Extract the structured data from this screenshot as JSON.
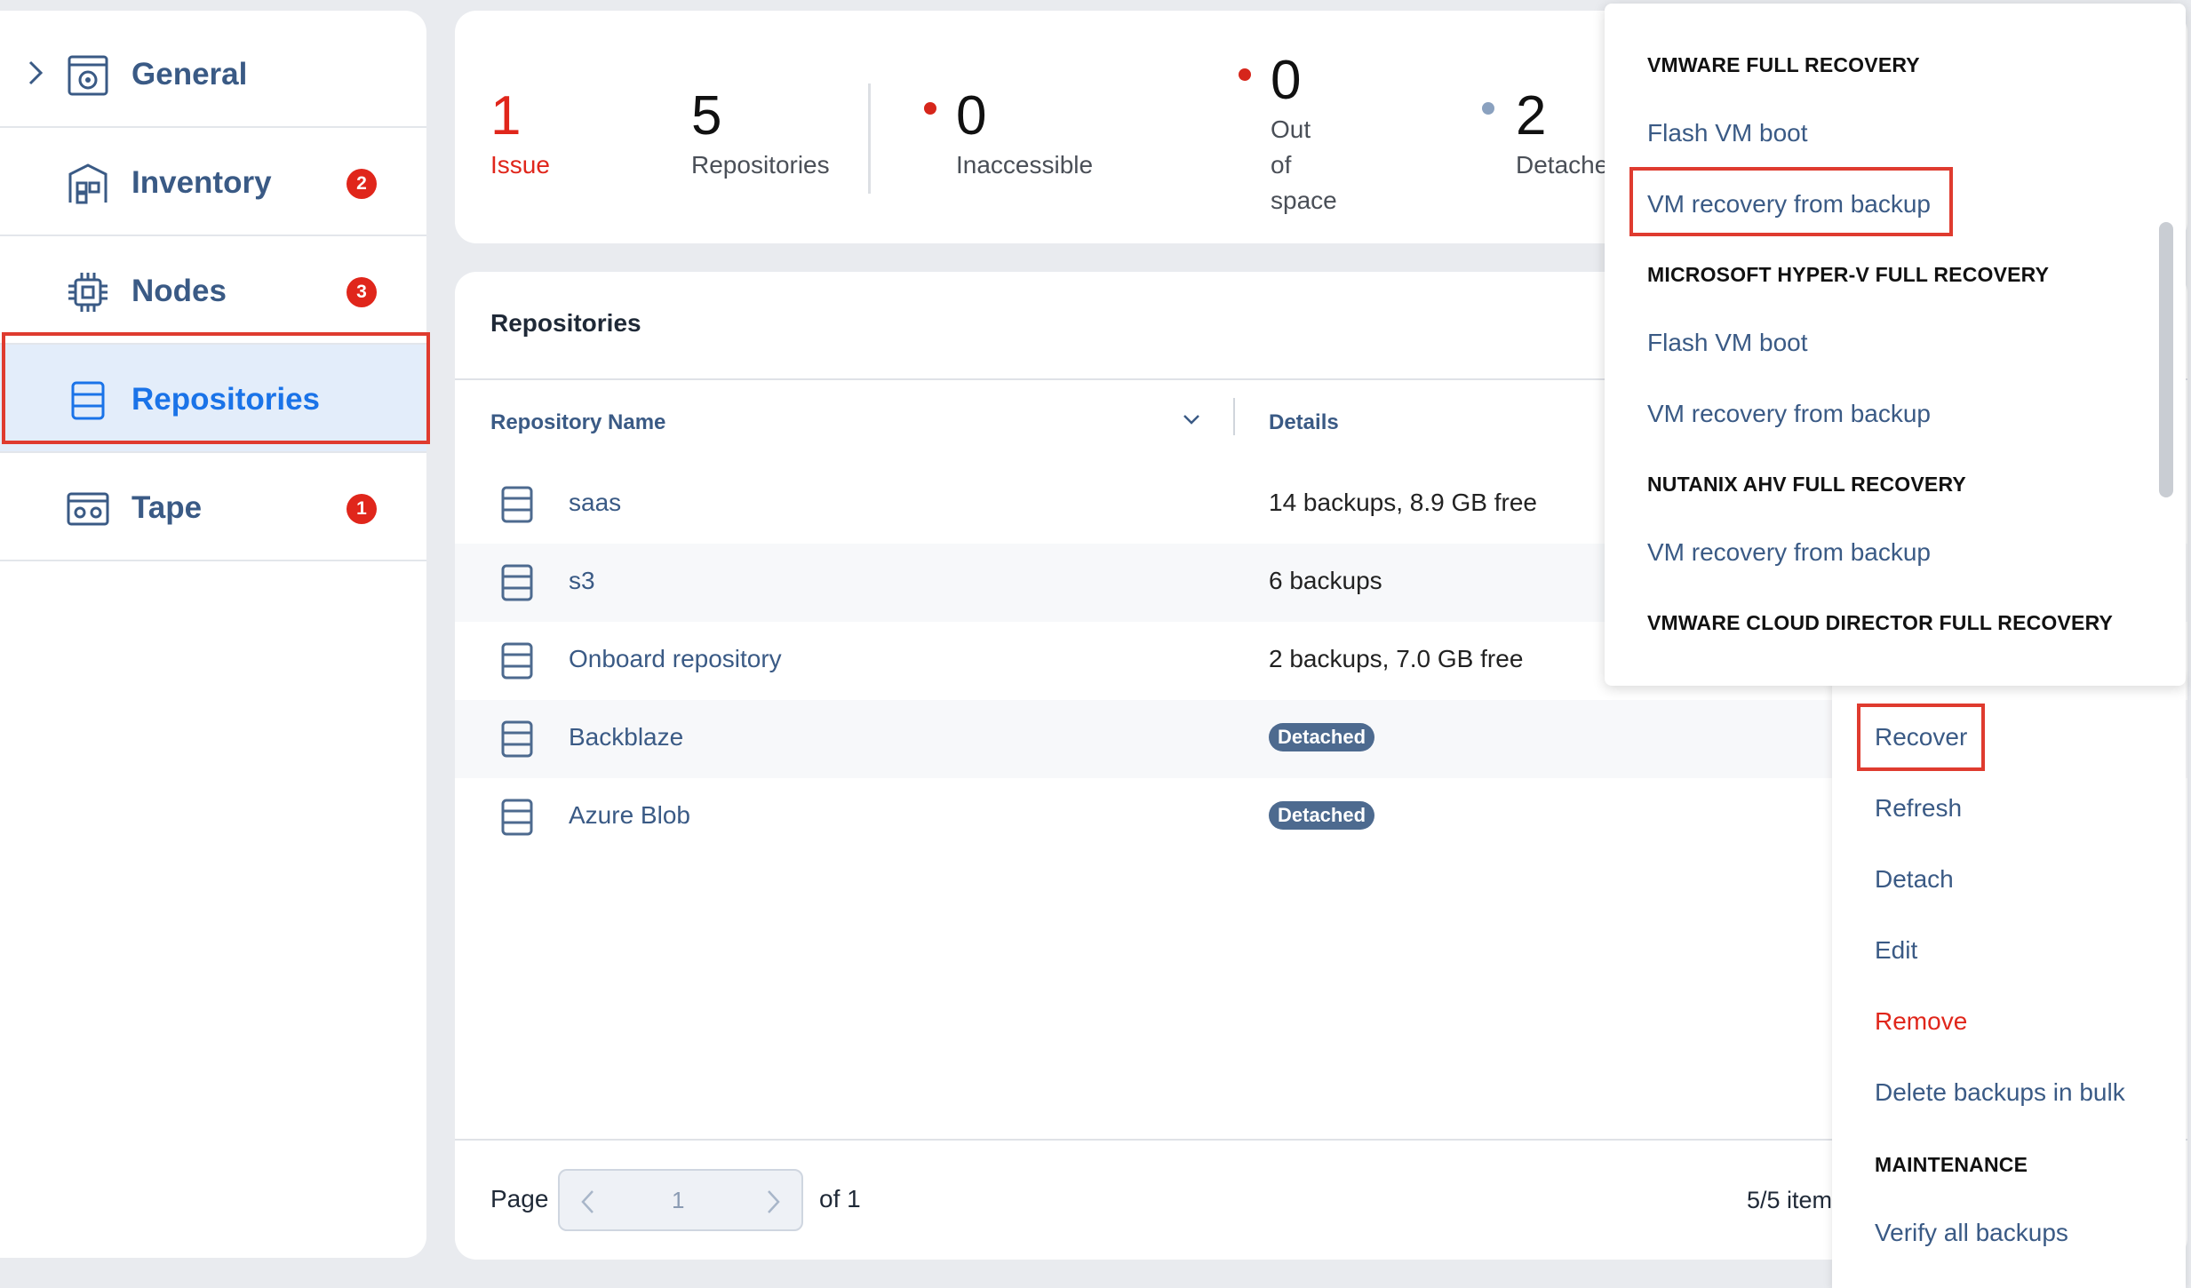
{
  "sidebar": {
    "items": [
      {
        "label": "General",
        "badge": "",
        "icon": "settings-gear-icon"
      },
      {
        "label": "Inventory",
        "badge": "2",
        "icon": "building-icon"
      },
      {
        "label": "Nodes",
        "badge": "3",
        "icon": "chip-icon"
      },
      {
        "label": "Repositories",
        "badge": "",
        "icon": "database-icon"
      },
      {
        "label": "Tape",
        "badge": "1",
        "icon": "tape-icon"
      }
    ]
  },
  "summary": {
    "issue": {
      "value": "1",
      "label": "Issue"
    },
    "repositories": {
      "value": "5",
      "label": "Repositories"
    },
    "inaccessible": {
      "value": "0",
      "label": "Inaccessible"
    },
    "out_of_space": {
      "value": "0",
      "label_lines": [
        "Out",
        "of",
        "space"
      ]
    },
    "detached": {
      "value": "2",
      "label": "Detache"
    }
  },
  "repos": {
    "title": "Repositories",
    "columns": {
      "name": "Repository Name",
      "details": "Details"
    },
    "rows": [
      {
        "name": "saas",
        "details": "14 backups, 8.9 GB free",
        "badge": ""
      },
      {
        "name": "s3",
        "details": "6 backups",
        "badge": ""
      },
      {
        "name": "Onboard repository",
        "details": "2 backups, 7.0 GB free",
        "badge": ""
      },
      {
        "name": "Backblaze",
        "details": "",
        "badge": "Detached"
      },
      {
        "name": "Azure Blob",
        "details": "",
        "badge": "Detached"
      }
    ],
    "pager": {
      "label": "Page",
      "current": "1",
      "of": "of 1",
      "items": "5/5 item"
    }
  },
  "menu": {
    "recover": "Recover",
    "refresh": "Refresh",
    "detach": "Detach",
    "edit": "Edit",
    "remove": "Remove",
    "delete_bulk": "Delete backups in bulk",
    "maintenance_header": "MAINTENANCE",
    "verify_all": "Verify all backups"
  },
  "submenu": {
    "vmware_header": "VMWARE FULL RECOVERY",
    "vmware_flash": "Flash VM boot",
    "vmware_recovery": "VM recovery from backup",
    "hyperv_header": "MICROSOFT HYPER-V FULL RECOVERY",
    "hyperv_flash": "Flash VM boot",
    "hyperv_recovery": "VM recovery from backup",
    "nutanix_header": "NUTANIX AHV FULL RECOVERY",
    "nutanix_recovery": "VM recovery from backup",
    "vcd_header": "VMWARE CLOUD DIRECTOR FULL RECOVERY"
  },
  "colors": {
    "accent": "#1a73e8",
    "link": "#3a5a85",
    "danger": "#e0261b",
    "highlight_box": "#df3b2f",
    "detached_badge": "#4d6a8f"
  }
}
